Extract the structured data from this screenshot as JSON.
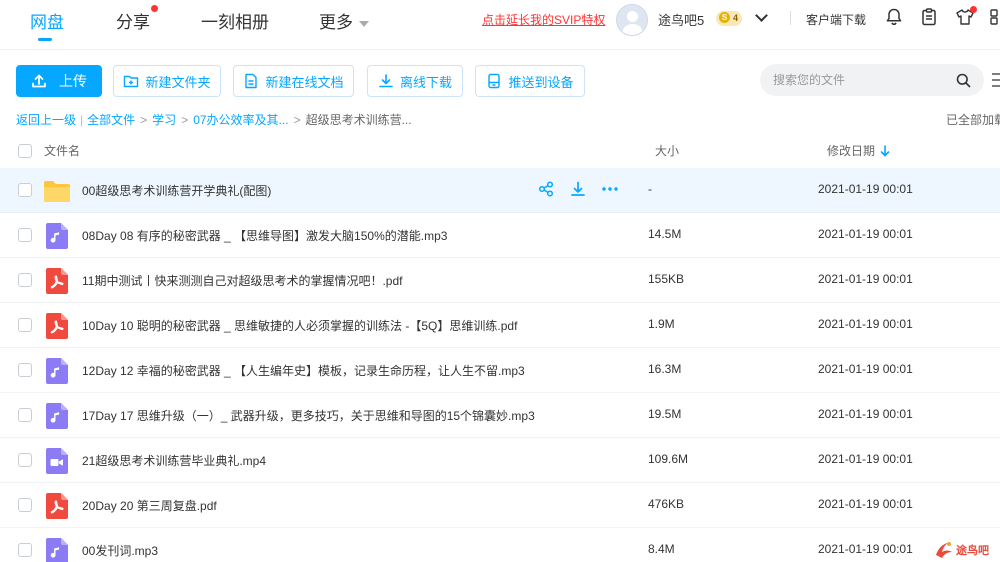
{
  "nav": {
    "tabs": [
      {
        "label": "网盘"
      },
      {
        "label": "分享"
      },
      {
        "label": "一刻相册"
      },
      {
        "label": "更多"
      }
    ],
    "svip_link": "点击延长我的SVIP特权",
    "username": "途鸟吧5",
    "vip_level": "4",
    "vip_coin": "S",
    "client_download": "客户端下载"
  },
  "toolbar": {
    "upload": "上传",
    "new_folder": "新建文件夹",
    "new_online_doc": "新建在线文档",
    "offline_download": "离线下载",
    "push_to_device": "推送到设备",
    "search_placeholder": "搜索您的文件"
  },
  "breadcrumb": {
    "back": "返回上一级",
    "all_files": "全部文件",
    "items": [
      "学习",
      "07办公效率及其...",
      "超级思考术训练营..."
    ],
    "loaded_status": "已全部加载"
  },
  "list_header": {
    "name": "文件名",
    "size": "大小",
    "modified": "修改日期"
  },
  "files": [
    {
      "name": "00超级思考术训练营开学典礼(配图)",
      "size": "-",
      "date": "2021-01-19 00:01",
      "type": "folder"
    },
    {
      "name": "08Day 08 有序的秘密武器 _ 【思维导图】激发大脑150%的潜能.mp3",
      "size": "14.5M",
      "date": "2021-01-19 00:01",
      "type": "audio"
    },
    {
      "name": "11期中测试丨快来测测自己对超级思考术的掌握情况吧！.pdf",
      "size": "155KB",
      "date": "2021-01-19 00:01",
      "type": "pdf"
    },
    {
      "name": "10Day 10 聪明的秘密武器 _ 思维敏捷的人必须掌握的训练法 -【5Q】思维训练.pdf",
      "size": "1.9M",
      "date": "2021-01-19 00:01",
      "type": "pdf"
    },
    {
      "name": "12Day 12 幸福的秘密武器 _ 【人生编年史】模板，记录生命历程，让人生不留.mp3",
      "size": "16.3M",
      "date": "2021-01-19 00:01",
      "type": "audio"
    },
    {
      "name": "17Day 17 思维升级（一）_ 武器升级，更多技巧，关于思维和导图的15个锦囊妙.mp3",
      "size": "19.5M",
      "date": "2021-01-19 00:01",
      "type": "audio"
    },
    {
      "name": "21超级思考术训练营毕业典礼.mp4",
      "size": "109.6M",
      "date": "2021-01-19 00:01",
      "type": "video"
    },
    {
      "name": "20Day 20 第三周复盘.pdf",
      "size": "476KB",
      "date": "2021-01-19 00:01",
      "type": "pdf"
    },
    {
      "name": "00发刊词.mp3",
      "size": "8.4M",
      "date": "2021-01-19 00:01",
      "type": "audio"
    }
  ],
  "watermark": "途鸟吧",
  "colors": {
    "accent": "#06a7ff",
    "svip_red": "#ff3333",
    "folder": "#ffc53d",
    "audio": "#8b7cf6",
    "pdf": "#f04a3e",
    "video": "#8b7cf6",
    "row_hover": "#eef7ff"
  },
  "icons": {
    "bell": "bell-icon",
    "clipboard": "clipboard-icon",
    "shirt": "skin-icon",
    "grid": "apps-icon",
    "search": "search-icon",
    "share": "share-icon",
    "download": "download-icon",
    "more": "more-icon"
  }
}
